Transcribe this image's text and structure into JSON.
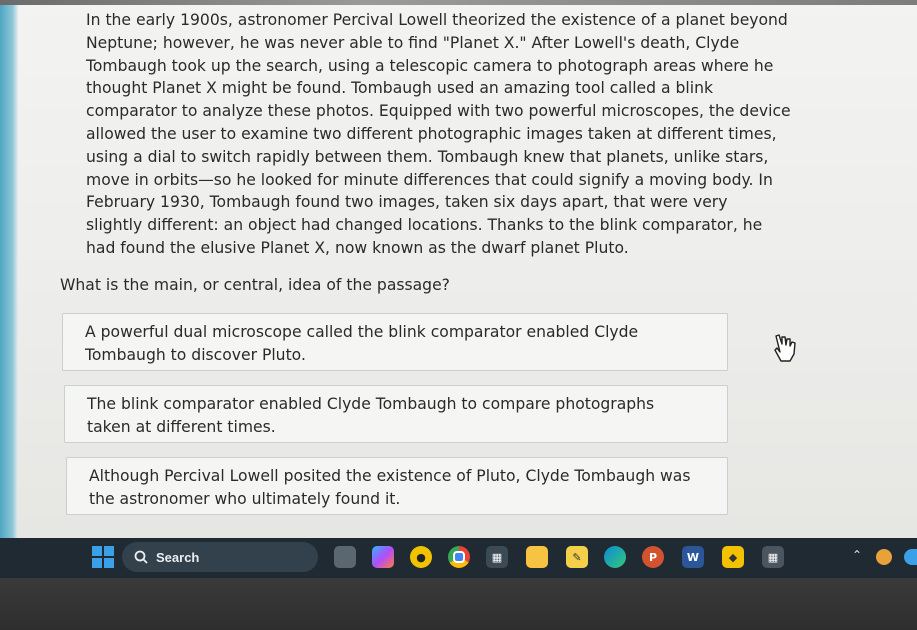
{
  "passage": {
    "lines": [
      "In the early 1900s, astronomer Percival Lowell theorized the existence of a planet beyond",
      "Neptune; however, he was never able to find \"Planet X.\" After Lowell's death, Clyde",
      "Tombaugh took up the search, using a telescopic camera to photograph areas where he",
      "thought Planet X might be found. Tombaugh used an amazing tool called a blink",
      "comparator to analyze these photos. Equipped with two powerful microscopes, the device",
      "allowed the user to examine two different photographic images taken at different times,",
      "using a dial to switch rapidly between them. Tombaugh knew that planets, unlike stars,",
      "move in orbits—so he looked for minute differences that could signify a moving body. In",
      "February 1930, Tombaugh found two images, taken six days apart, that were very",
      "slightly different: an object had changed locations. Thanks to the blink comparator, he",
      "had found the elusive Planet X, now known as the dwarf planet Pluto."
    ]
  },
  "question": "What is the main, or central, idea of the passage?",
  "options": [
    {
      "line1": "A powerful dual microscope called the blink comparator enabled Clyde",
      "line2": "Tombaugh to discover Pluto."
    },
    {
      "line1": "The blink comparator enabled Clyde Tombaugh to compare photographs",
      "line2": "taken at different times."
    },
    {
      "line1": "Although Percival Lowell posited the existence of Pluto, Clyde Tombaugh was",
      "line2": "the astronomer who ultimately found it."
    }
  ],
  "taskbar": {
    "search_label": "Search",
    "icons": [
      "start-icon",
      "search-icon",
      "widget-icon",
      "copilot-icon",
      "media-icon",
      "chrome-icon",
      "store-icon",
      "file-explorer-icon",
      "sticky-notes-icon",
      "edge-icon",
      "powerpoint-icon",
      "word-icon",
      "security-icon",
      "calculator-icon"
    ],
    "colors": {
      "taskbar": "#1f2a33",
      "start": "#3aa0e8"
    }
  }
}
